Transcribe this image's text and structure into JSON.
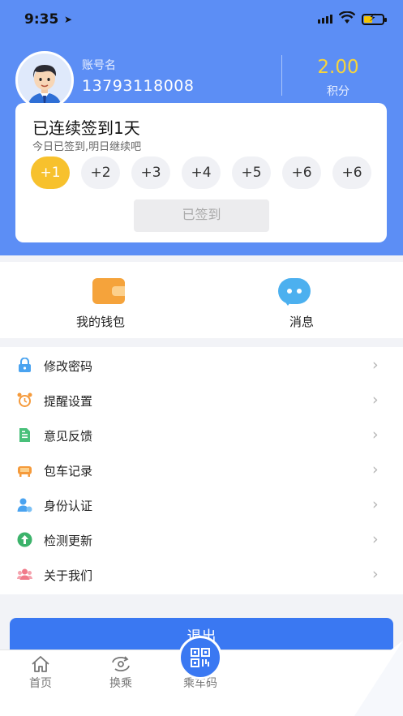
{
  "status": {
    "time": "9:35"
  },
  "profile": {
    "account_label": "账号名",
    "phone": "13793118008",
    "points_value": "2.00",
    "points_label": "积分"
  },
  "checkin": {
    "title": "已连续签到1天",
    "subtitle": "今日已签到,明日继续吧",
    "days": [
      "+1",
      "+2",
      "+3",
      "+4",
      "+5",
      "+6",
      "+6"
    ],
    "button_label": "已签到"
  },
  "quick": {
    "wallet_label": "我的钱包",
    "message_label": "消息"
  },
  "menu": [
    {
      "label": "修改密码",
      "icon": "lock-icon",
      "color": "#4aa3f0"
    },
    {
      "label": "提醒设置",
      "icon": "alarm-clock-icon",
      "color": "#f59a3b"
    },
    {
      "label": "意见反馈",
      "icon": "feedback-doc-icon",
      "color": "#49c07a"
    },
    {
      "label": "包车记录",
      "icon": "sofa-icon",
      "color": "#f59a3b"
    },
    {
      "label": "身份认证",
      "icon": "user-verify-icon",
      "color": "#4aa3f0"
    },
    {
      "label": "检测更新",
      "icon": "update-arrow-icon",
      "color": "#3cb36b"
    },
    {
      "label": "关于我们",
      "icon": "people-icon",
      "color": "#f07a8a"
    }
  ],
  "logout_label": "退出",
  "tabs": {
    "home": "首页",
    "transfer": "换乘",
    "ride_code": "乘车码"
  },
  "colors": {
    "primary": "#5c8ef5",
    "accent": "#3a78f2",
    "gold": "#f7c12d"
  }
}
